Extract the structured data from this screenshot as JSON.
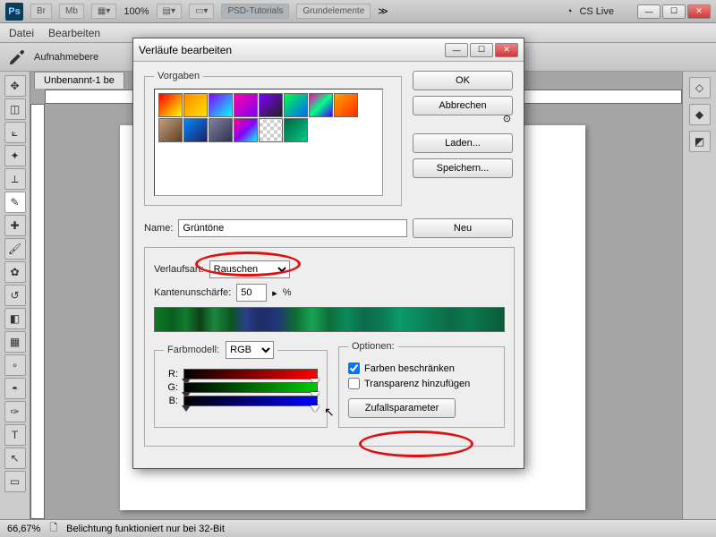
{
  "app": {
    "ps": "Ps",
    "zoom": "100% ",
    "tab1": "PSD-Tutorials",
    "tab2": "Grundelemente",
    "cslive": "CS Live"
  },
  "menu": {
    "file": "Datei",
    "edit": "Bearbeiten"
  },
  "optbar": {
    "label": "Aufnahmebere"
  },
  "doc": {
    "tab": "Unbenannt-1 be"
  },
  "status": {
    "zoom": "66,67%",
    "msg": "Belichtung funktioniert nur bei 32-Bit"
  },
  "dialog": {
    "title": "Verläufe bearbeiten",
    "presets_legend": "Vorgaben",
    "ok": "OK",
    "cancel": "Abbrechen",
    "load": "Laden...",
    "save": "Speichern...",
    "new": "Neu",
    "name_label": "Name:",
    "name_value": "Grüntöne",
    "type_label": "Verlaufsart:",
    "type_value": "Rauschen",
    "rough_label": "Kantenunschärfe:",
    "rough_value": "50",
    "rough_pct": "%",
    "colormodel_legend": "Farbmodell:",
    "colormodel_value": "RGB",
    "r": "R:",
    "g": "G:",
    "b": "B:",
    "options_legend": "Optionen:",
    "restrict": "Farben beschränken",
    "transp": "Transparenz hinzufügen",
    "random": "Zufallsparameter"
  },
  "swatches": [
    "linear-gradient(135deg,#ff0000,#ffff00)",
    "linear-gradient(135deg,#ff8c00,#ffe000)",
    "linear-gradient(135deg,#8800ff,#00ffff)",
    "linear-gradient(135deg,#ff00a0,#8000ff)",
    "linear-gradient(135deg,#8000ff,#202020)",
    "linear-gradient(135deg,#00ff44,#0066ff)",
    "linear-gradient(135deg,#ff00aa,#00ff88,#4400ff)",
    "linear-gradient(135deg,#ffa000,#ff3000)",
    "linear-gradient(135deg,#c0a080,#604020)",
    "linear-gradient(135deg,#0088ff,#202060)",
    "linear-gradient(135deg,#8080a0,#303050)",
    "linear-gradient(135deg,#ff0088,#8800ff,#00ffff)",
    "repeating-conic-gradient(#ccc 0 25%, #fff 0 50%) 0/8px 8px",
    "linear-gradient(135deg,#006644,#00cc88)"
  ]
}
